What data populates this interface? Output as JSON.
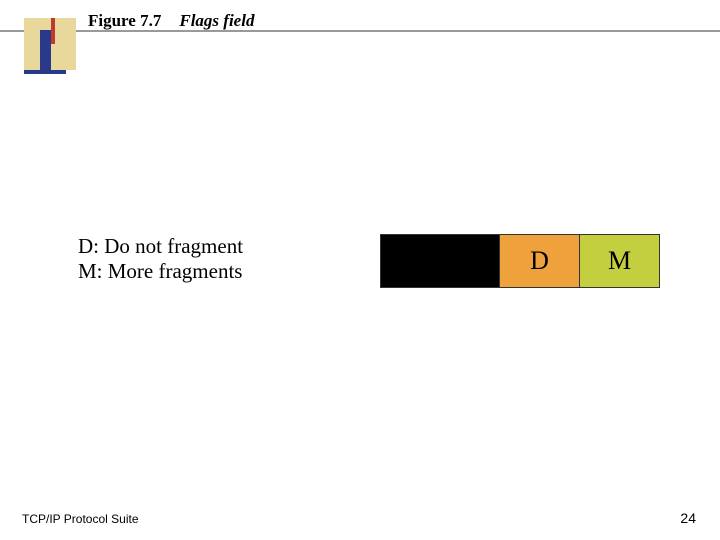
{
  "header": {
    "figure_label": "Figure 7.7",
    "figure_title": "Flags field"
  },
  "legend": {
    "line1": "D: Do not fragment",
    "line2": "M: More fragments"
  },
  "flags": {
    "seg_reserved": "",
    "seg_d": "D",
    "seg_m": "M",
    "colors": {
      "reserved": "#000000",
      "d": "#efa23c",
      "m": "#c3cf3f"
    }
  },
  "footer": {
    "left": "TCP/IP Protocol Suite",
    "page": "24"
  }
}
